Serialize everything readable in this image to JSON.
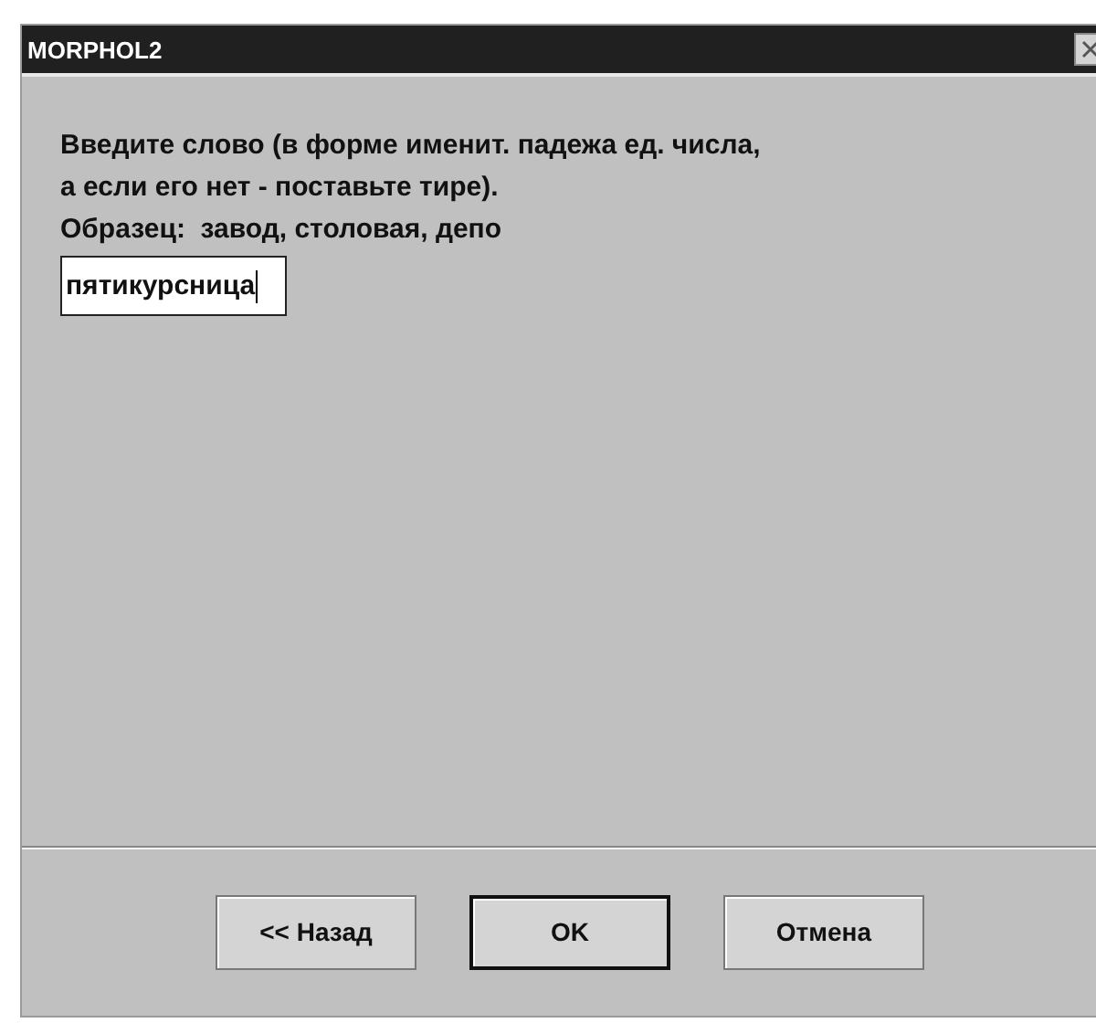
{
  "window": {
    "title": "MORPHOL2"
  },
  "prompt_lines": [
    "Введите слово (в форме именит. падежа ед. числа,",
    "а если его нет - поставьте тире).",
    "Образец:  завод, столовая, депо"
  ],
  "word_field": {
    "value": "пятикурсница",
    "focused": true
  },
  "buttons": [
    {
      "label": "<< Назад",
      "default": false
    },
    {
      "label": "OK",
      "default": true
    },
    {
      "label": "Отмена",
      "default": false
    }
  ]
}
